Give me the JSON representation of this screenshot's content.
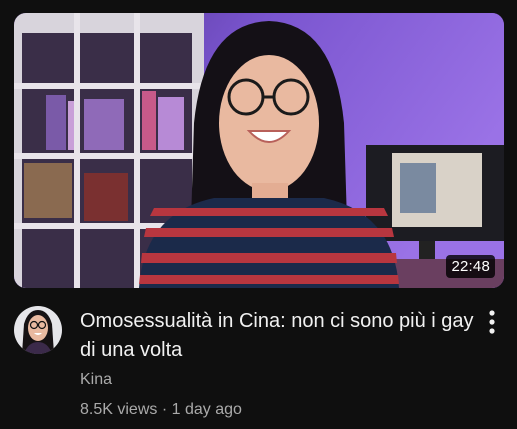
{
  "video": {
    "title": "Omosessualità in Cina: non ci sono più i gay di una volta",
    "duration": "22:48",
    "channel": "Kina",
    "views": "8.5K views",
    "separator": "·",
    "age": "1 day ago"
  },
  "icons": {
    "menu": "more-vert-icon",
    "avatar": "channel-avatar"
  },
  "colors": {
    "background": "#0f0f0f",
    "title": "#f1f1f1",
    "secondary": "#aaaaaa",
    "thumbnail_purple": "#7b4fd0"
  }
}
